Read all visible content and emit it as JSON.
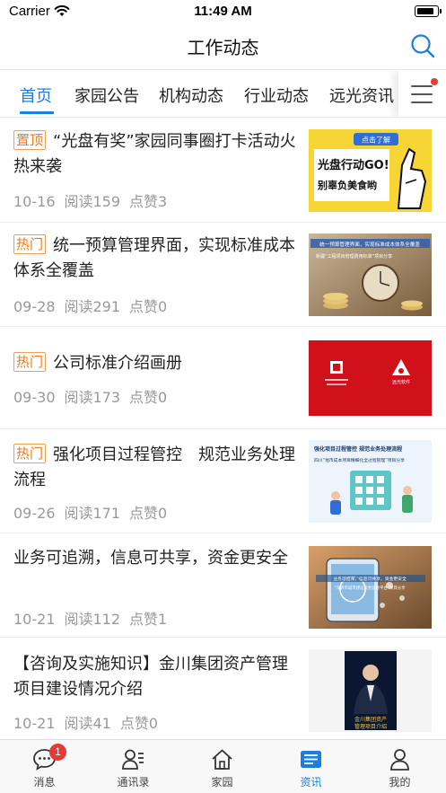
{
  "status_bar": {
    "carrier": "Carrier",
    "time": "11:49 AM",
    "battery_level": 0.85
  },
  "nav": {
    "title": "工作动态"
  },
  "tabs": [
    {
      "label": "首页",
      "active": true
    },
    {
      "label": "家园公告",
      "active": false
    },
    {
      "label": "机构动态",
      "active": false
    },
    {
      "label": "行业动态",
      "active": false
    },
    {
      "label": "远光资讯",
      "active": false
    }
  ],
  "articles": [
    {
      "badge": "置顶",
      "title": "“光盘有奖”家园同事圈打卡活动火热来袭",
      "date": "10-16",
      "reads": "阅读159",
      "likes": "点赞3",
      "thumb": {
        "tag": "点击了解",
        "line1": "光盘行动GO!",
        "line2": "别辜负美食哟"
      }
    },
    {
      "badge": "热门",
      "title": "统一预算管理界面，实现标准成本体系全覆盖",
      "date": "09-28",
      "reads": "阅读291",
      "likes": "点赞0",
      "thumb": {
        "line1": "统一预算管理界面，实现标准成本体系全覆盖",
        "line2": "新疆“工程项目管理费用标准”项目分享"
      }
    },
    {
      "badge": "热门",
      "title": "公司标准介绍画册",
      "date": "09-30",
      "reads": "阅读173",
      "likes": "点赞0",
      "thumb": {
        "line1": "远光软件"
      }
    },
    {
      "badge": "热门",
      "title": "强化项目过程管控　规范业务处理流程",
      "date": "09-26",
      "reads": "阅读171",
      "likes": "点赞0",
      "thumb": {
        "line1": "强化项目过程管控  规范业务处理流程",
        "line2": "四川“地市成本项目精细化全过程管理”项目分享"
      }
    },
    {
      "badge": "",
      "title": "业务可追溯，信息可共享，资金更安全",
      "date": "10-21",
      "reads": "阅读112",
      "likes": "点赞1",
      "thumb": {
        "line1": "业务可追溯，信息可共享，资金更安全",
        "line2": "“深圳市城市建设资金监管平台”项目分享"
      }
    },
    {
      "badge": "",
      "title": "【咨询及实施知识】金川集团资产管理项目建设情况介绍",
      "date": "10-21",
      "reads": "阅读41",
      "likes": "点赞0",
      "thumb": {
        "line1": "金川集团资产",
        "line2": "管理项目介绍"
      }
    }
  ],
  "tab_bar": [
    {
      "label": "消息",
      "icon": "chat-bubble-icon",
      "badge": "1",
      "active": false
    },
    {
      "label": "通讯录",
      "icon": "contacts-icon",
      "badge": "",
      "active": false
    },
    {
      "label": "家园",
      "icon": "home-icon",
      "badge": "",
      "active": false
    },
    {
      "label": "资讯",
      "icon": "news-icon",
      "badge": "",
      "active": true
    },
    {
      "label": "我的",
      "icon": "profile-icon",
      "badge": "",
      "active": false
    }
  ],
  "colors": {
    "accent": "#1a7fdf",
    "badge_orange": "#f07a16",
    "notification_red": "#e53935"
  }
}
